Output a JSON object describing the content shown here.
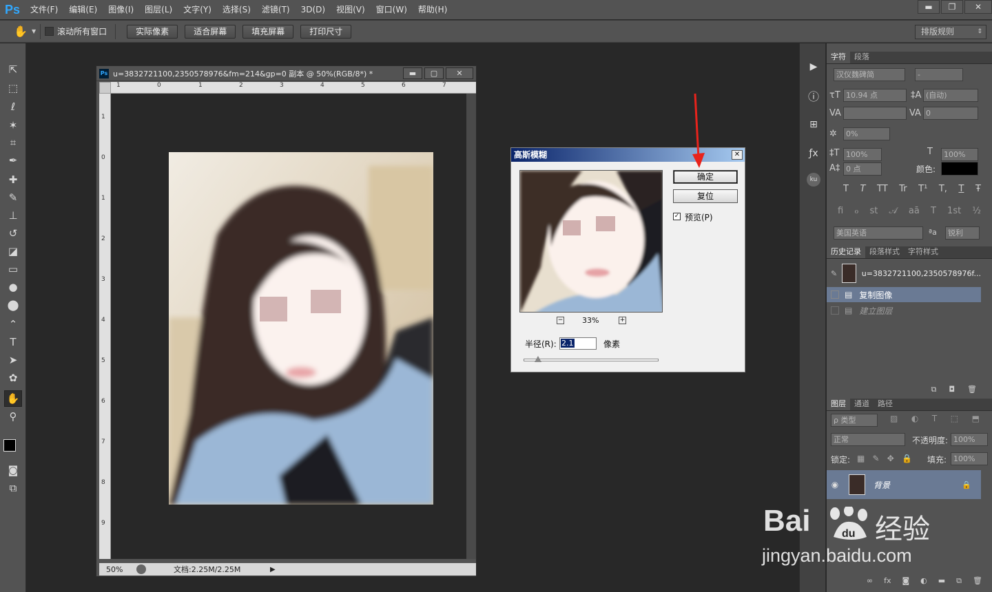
{
  "app": {
    "logo": "Ps"
  },
  "menu": [
    "文件(F)",
    "编辑(E)",
    "图像(I)",
    "图层(L)",
    "文字(Y)",
    "选择(S)",
    "滤镜(T)",
    "3D(D)",
    "视图(V)",
    "窗口(W)",
    "帮助(H)"
  ],
  "window_controls": {
    "minimize": "▬",
    "restore": "❐",
    "close": "✕"
  },
  "options_bar": {
    "scroll_all_label": "滚动所有窗口",
    "buttons": [
      "实际像素",
      "适合屏幕",
      "填充屏幕",
      "打印尺寸"
    ],
    "workspace": "排版规则"
  },
  "document": {
    "title": "u=3832721100,2350578976&fm=214&gp=0 副本 @ 50%(RGB/8*) *",
    "icon": "Ps",
    "zoom": "50%",
    "doc_info": "文档:2.25M/2.25M",
    "ruler_h": [
      "1",
      "0",
      "1",
      "2",
      "3",
      "4",
      "5",
      "6",
      "7"
    ],
    "ruler_v": [
      "1",
      "0",
      "1",
      "2",
      "3",
      "4",
      "5",
      "6",
      "7",
      "8",
      "9"
    ]
  },
  "dialog": {
    "title": "高斯模糊",
    "ok": "确定",
    "reset": "复位",
    "preview_label": "预览(P)",
    "preview_checked": true,
    "zoom": "33%",
    "radius_label": "半径(R):",
    "radius_value": "2.1",
    "radius_unit": "像素"
  },
  "character_panel": {
    "tabs": [
      "字符",
      "段落"
    ],
    "font_family": "汉仪魏碑简",
    "font_style": "-",
    "font_size": "10.94 点",
    "leading": "(自动)",
    "kerning": "",
    "tracking": "0",
    "tsume": "0%",
    "vscale": "100%",
    "hscale": "100%",
    "baseline": "0 点",
    "color_label": "颜色:",
    "color": "#000000",
    "style_glyphs": [
      "T",
      "T",
      "TT",
      "Tr",
      "T¹",
      "T,",
      "T",
      "Ŧ"
    ],
    "ot_glyphs": [
      "fi",
      "ℴ",
      "st",
      "𝒜",
      "aā",
      "T",
      "1st",
      "½"
    ],
    "language": "美国英语",
    "aa_icon": "ªa",
    "antialias": "锐利"
  },
  "history_panel": {
    "tabs": [
      "历史记录",
      "段落样式",
      "字符样式"
    ],
    "snapshot": "u=3832721100,2350578976f...",
    "steps": [
      "复制图像",
      "建立图层"
    ]
  },
  "layers_panel": {
    "tabs": [
      "图层",
      "通道",
      "路径"
    ],
    "filter": "ρ 类型",
    "blend_mode": "正常",
    "opacity_label": "不透明度:",
    "opacity": "100%",
    "lock_label": "锁定:",
    "fill_label": "填充:",
    "fill": "100%",
    "layer_name": "背景"
  },
  "watermark": {
    "brand": "Bai",
    "brand2": "经验",
    "url": "jingyan.baidu.com"
  }
}
